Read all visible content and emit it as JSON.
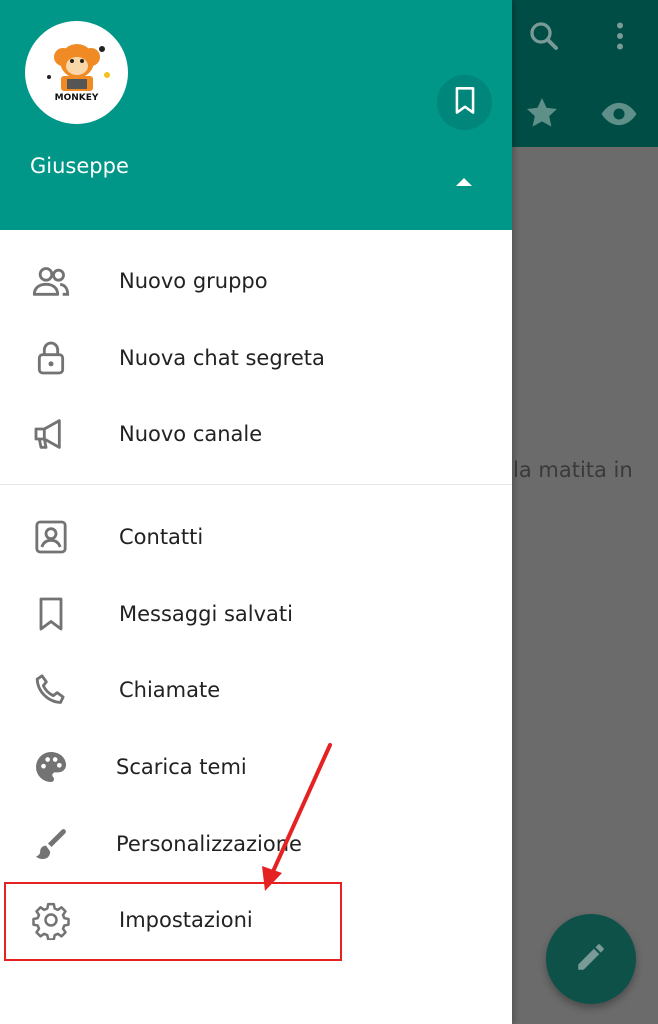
{
  "background": {
    "hint_text": "la matita in",
    "top_icons": [
      "search-icon",
      "more-vert-icon"
    ],
    "filter_icons": [
      "star-icon",
      "eye-icon"
    ],
    "fab_icon": "pencil-icon"
  },
  "drawer": {
    "user_name": "Giuseppe",
    "avatar_brand": "MONKEY",
    "header_color": "#009688",
    "items": [
      {
        "label": "Nuovo gruppo",
        "icon": "group-icon"
      },
      {
        "label": "Nuova chat segreta",
        "icon": "lock-icon"
      },
      {
        "label": "Nuovo canale",
        "icon": "megaphone-icon"
      },
      {
        "label": "Contatti",
        "icon": "contact-icon"
      },
      {
        "label": "Messaggi salvati",
        "icon": "bookmark-icon"
      },
      {
        "label": "Chiamate",
        "icon": "phone-icon"
      },
      {
        "label": "Scarica temi",
        "icon": "palette-icon"
      },
      {
        "label": "Personalizzazione",
        "icon": "brush-icon"
      },
      {
        "label": "Impostazioni",
        "icon": "gear-icon"
      }
    ]
  },
  "annotation": {
    "color": "#e52222"
  }
}
